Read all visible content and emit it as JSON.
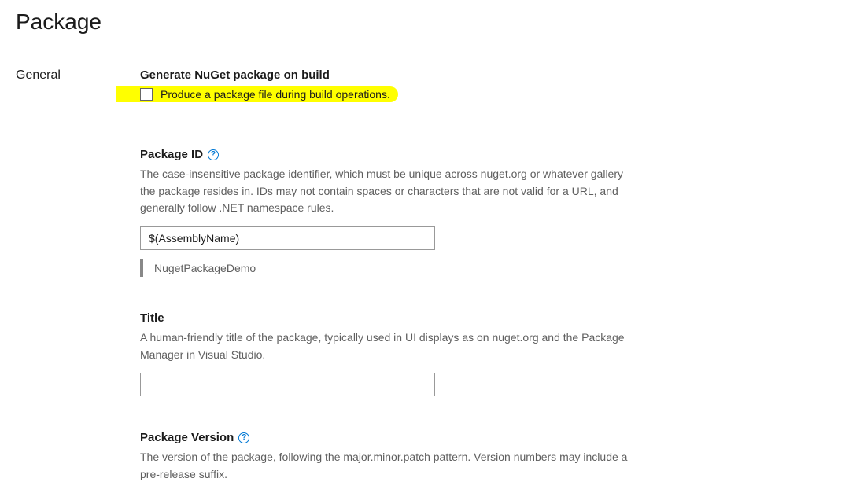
{
  "page_title": "Package",
  "section_label": "General",
  "generate": {
    "label": "Generate NuGet package on build",
    "checkbox_text": "Produce a package file during build operations."
  },
  "package_id": {
    "label": "Package ID",
    "help_glyph": "?",
    "desc": "The case-insensitive package identifier, which must be unique across nuget.org or whatever gallery the package resides in. IDs may not contain spaces or characters that are not valid for a URL, and generally follow .NET namespace rules.",
    "value": "$(AssemblyName)",
    "resolved": "NugetPackageDemo"
  },
  "title_field": {
    "label": "Title",
    "desc": "A human-friendly title of the package, typically used in UI displays as on nuget.org and the Package Manager in Visual Studio.",
    "value": ""
  },
  "package_version": {
    "label": "Package Version",
    "help_glyph": "?",
    "desc": "The version of the package, following the major.minor.patch pattern. Version numbers may include a pre-release suffix."
  }
}
